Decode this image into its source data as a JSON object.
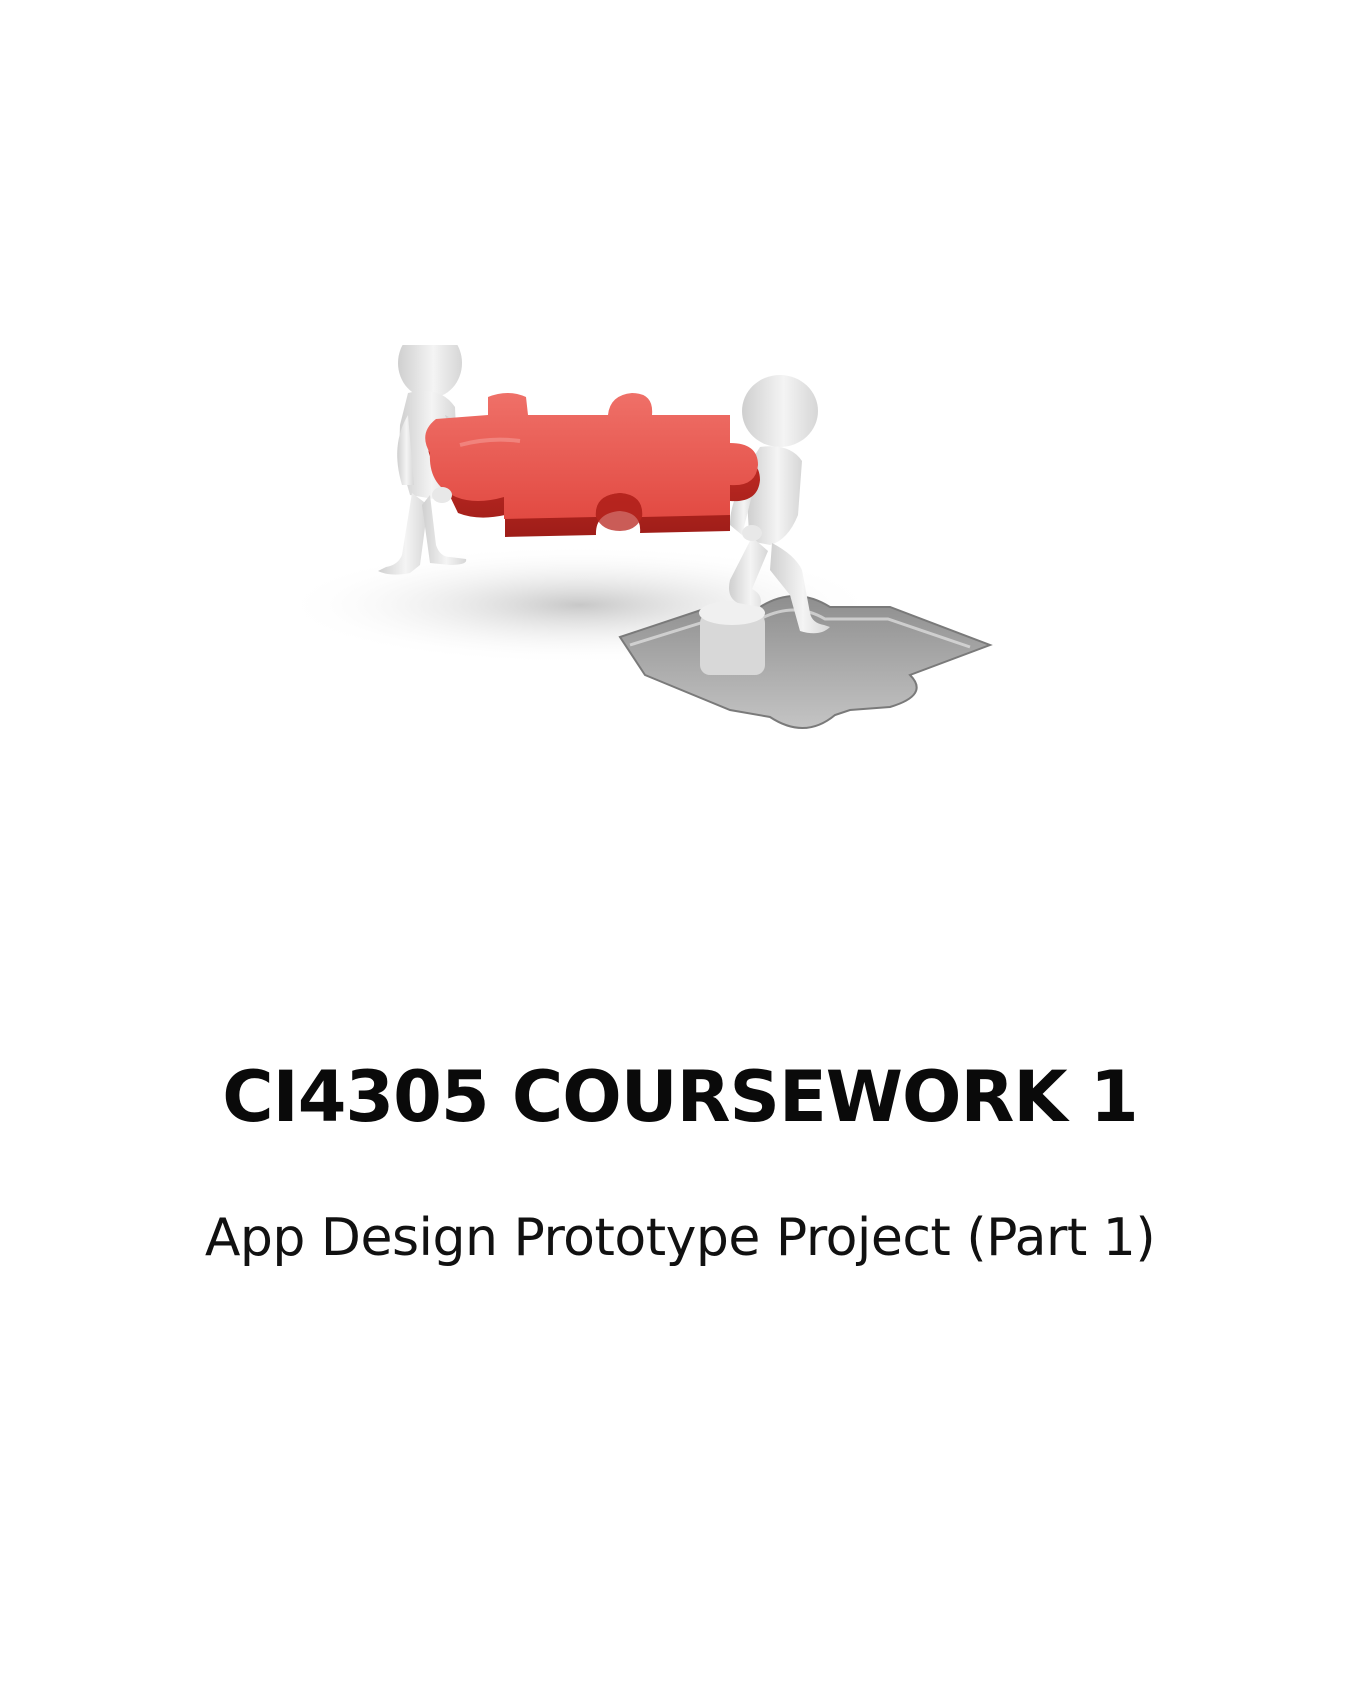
{
  "document": {
    "title": "CI4305 COURSEWORK 1",
    "subtitle": "App Design Prototype Project (Part 1)"
  },
  "illustration": {
    "icon": "puzzle-teamwork-illustration",
    "colors": {
      "puzzle_piece": "#e0453f",
      "figures": "#e9e9e9",
      "hole": "#b8b8b8"
    }
  }
}
